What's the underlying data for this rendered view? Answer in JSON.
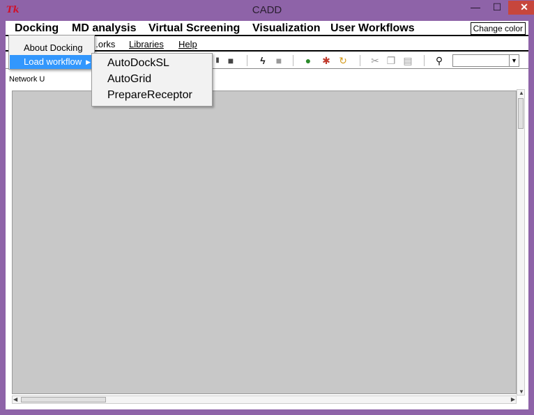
{
  "window": {
    "title": "CADD",
    "icon_label": "Tk"
  },
  "titlebar_buttons": {
    "minimize": "—",
    "maximize": "☐",
    "close": "✕"
  },
  "menubar1": {
    "items": [
      "Docking",
      "MD analysis",
      "Virtual Screening",
      "Visualization",
      "User Workflows"
    ],
    "change_color": "Change color"
  },
  "menubar2": {
    "items": [
      "...orks",
      "Libraries",
      "Help"
    ]
  },
  "toolbar": {
    "combo_value": ""
  },
  "tabs": {
    "network": "Network U"
  },
  "dropdown": {
    "about": "About  Docking",
    "load": "Load workflow"
  },
  "submenu": {
    "items": [
      "AutoDockSL",
      "AutoGrid",
      "PrepareReceptor"
    ]
  },
  "colors": {
    "highlight": "#3297fd",
    "frame": "#8e63a8",
    "canvas": "#c8c8c8"
  }
}
